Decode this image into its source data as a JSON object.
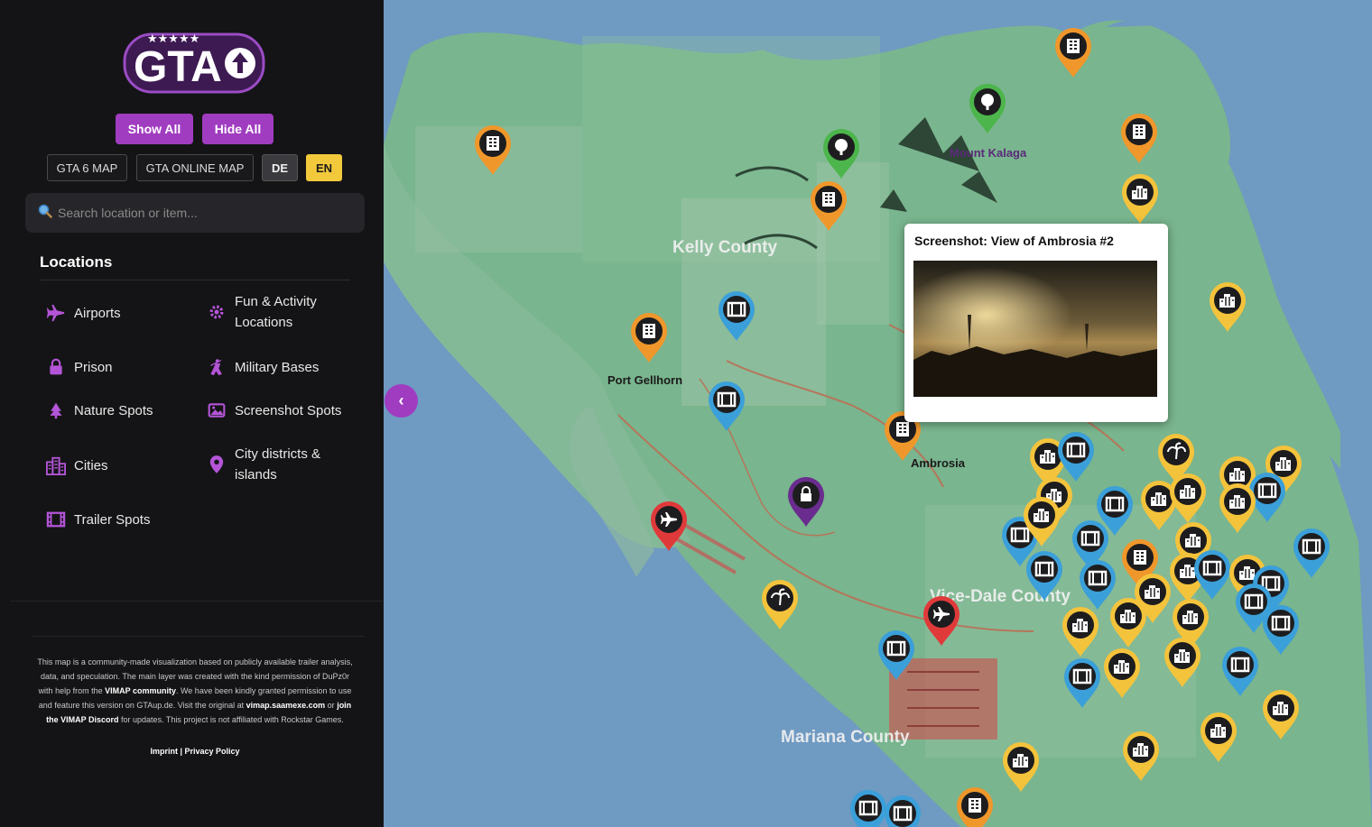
{
  "sidebar": {
    "logo": {
      "text": "GTA",
      "stars": "★★★★★"
    },
    "show_all": "Show All",
    "hide_all": "Hide All",
    "map_buttons": [
      "GTA 6 MAP",
      "GTA ONLINE MAP"
    ],
    "lang": [
      "DE",
      "EN"
    ],
    "active_lang": "EN",
    "search_placeholder": "Search location or item...",
    "locations_title": "Locations",
    "categories": [
      {
        "label": "Airports",
        "icon": "plane-icon"
      },
      {
        "label": "Fun & Activity Locations",
        "icon": "gear-icon"
      },
      {
        "label": "Prison",
        "icon": "lock-icon"
      },
      {
        "label": "Military Bases",
        "icon": "soldier-icon"
      },
      {
        "label": "Nature Spots",
        "icon": "tree-icon"
      },
      {
        "label": "Screenshot Spots",
        "icon": "image-icon"
      },
      {
        "label": "Cities",
        "icon": "city-icon"
      },
      {
        "label": "City districts & islands",
        "icon": "map-pin-icon"
      },
      {
        "label": "Trailer Spots",
        "icon": "film-icon"
      }
    ],
    "footer": {
      "p1": "This map is a community-made visualization based on publicly available trailer analysis, data, and speculation. The main layer was created with the kind permission of DuPz0r with help from the ",
      "vimap_community": "VIMAP community",
      "p2": ". We have been kindly granted permission to use and feature this version on GTAup.de. Visit the original at ",
      "vimap_url": "vimap.saamexe.com",
      "p3": " or ",
      "vimap_discord": "join the VIMAP Discord",
      "p4": " for updates. This project is not affiliated with Rockstar Games.",
      "imprint": "Imprint",
      "separator": "|",
      "privacy": "Privacy Policy"
    },
    "collapse_icon": "‹"
  },
  "map": {
    "regions": {
      "kelly": "Kelly County",
      "vicedale": "Vice-Dale County",
      "mariana": "Mariana County"
    },
    "place_labels": {
      "port_gellhorn": "Port Gellhorn",
      "ambrosia": "Ambrosia",
      "mount_kalaga": "Mount Kalaga"
    },
    "popup_title": "Screenshot: View of Ambrosia #2",
    "colors": {
      "orange": "#f0972b",
      "green": "#4cb54b",
      "yellow": "#f4c33c",
      "blue": "#3b9fd9",
      "red": "#e0393a",
      "purple": "#6a2c8e",
      "accent": "#a03cc0",
      "land": "#78b58e",
      "water": "#6f9ac2"
    }
  }
}
